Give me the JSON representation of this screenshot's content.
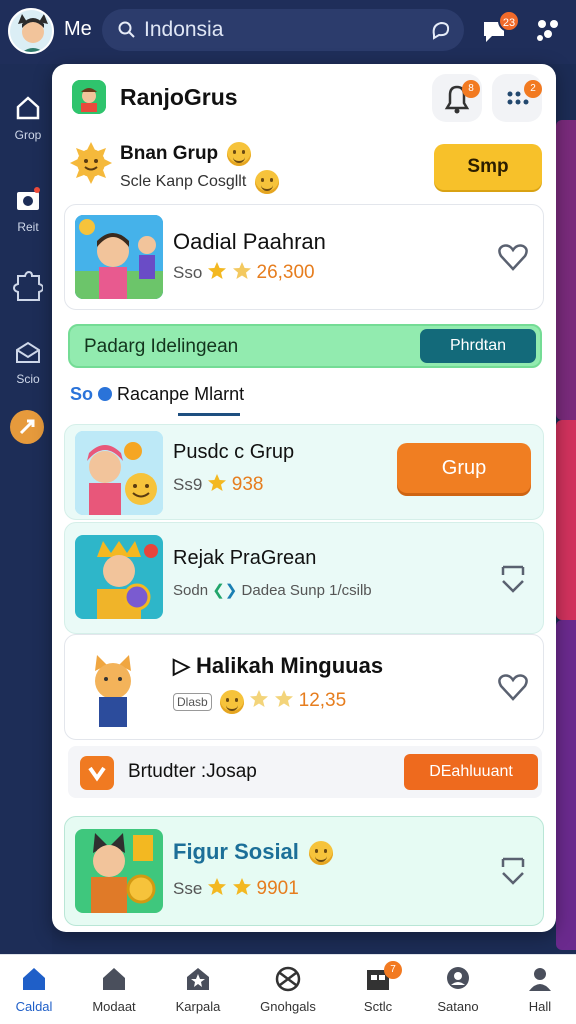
{
  "topbar": {
    "me_label": "Me",
    "search_text": "Indonsia",
    "notif_badge": "23"
  },
  "rail": {
    "items": [
      {
        "label": "Grop",
        "icon": "home-icon"
      },
      {
        "label": "Reit",
        "icon": "camera-icon"
      },
      {
        "label": "",
        "icon": "puzzle-icon"
      },
      {
        "label": "Scio",
        "icon": "mail-icon"
      }
    ]
  },
  "header": {
    "title": "RanjoGrus",
    "bell_badge": "8",
    "menu_badge": "2"
  },
  "brand": {
    "title": "Bnan Grup",
    "subtitle": "Scle Kanp Cosgllt",
    "join_label": "Smp"
  },
  "cards": [
    {
      "title": "Oadial Paahran",
      "prefix": "Sso",
      "value": "26,300",
      "action": "heart-icon"
    },
    {
      "title": "Pusdc c Grup",
      "prefix": "Ss9",
      "value": "938",
      "button": "Grup"
    },
    {
      "title": "Rejak PraGrean",
      "prefix": "Sodn",
      "sub": "Dadea Sunp 1/csilb",
      "action": "download-icon"
    },
    {
      "title": "Halikah Minguuas",
      "prefix": "Dlasb",
      "value": "12,35",
      "action": "heart-icon"
    },
    {
      "title": "Figur Sosial",
      "prefix": "Sse",
      "value": "9901",
      "action": "download-icon"
    }
  ],
  "banner": {
    "label": "Padarg Idelingean",
    "button": "Phrdtan"
  },
  "tabs": {
    "prefix": "So",
    "label": "Racanpe Mlarnt"
  },
  "promo": {
    "label": "Brtudter :Josap",
    "button": "DEahluuant"
  },
  "bottom_nav": [
    {
      "label": "Caldal",
      "icon": "home-icon",
      "active": true
    },
    {
      "label": "Modaat",
      "icon": "house-icon"
    },
    {
      "label": "Karpala",
      "icon": "star-house-icon"
    },
    {
      "label": "Gnohgals",
      "icon": "globe-icon"
    },
    {
      "label": "Sctlc",
      "icon": "store-icon",
      "badge": "7"
    },
    {
      "label": "Satano",
      "icon": "chat-icon"
    },
    {
      "label": "Hall",
      "icon": "user-icon"
    }
  ],
  "colors": {
    "accent": "#1f5fc8",
    "nav_bg": "#1f2e5a",
    "orange": "#f07e22",
    "yellow": "#f7c12a",
    "green_banner": "#92ebaf"
  }
}
